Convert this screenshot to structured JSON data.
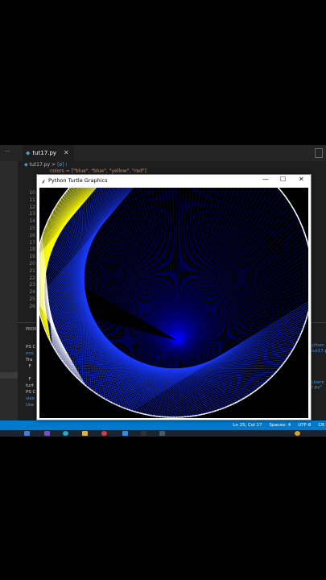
{
  "editor": {
    "tab_label": "tut17.py",
    "breadcrumb_file": "tut17.py",
    "breadcrumb_symbol": "[ø] i",
    "partial_code_line": "colors = [\"blue\", \"blue\", \"yellow\", \"red\"]",
    "line_numbers": [
      "10",
      "11",
      "12",
      "13",
      "14",
      "15",
      "16",
      "17",
      "18",
      "19",
      "20",
      "21",
      "22",
      "23",
      "24",
      "25",
      "26"
    ]
  },
  "panel": {
    "label": "PROBLEMS",
    "terminal_lines": [
      {
        "text": "PS C",
        "blue": false
      },
      {
        "text": "ons",
        "blue": true
      },
      {
        "text": "Tra",
        "blue": false
      },
      {
        "text": "  F",
        "blue": false
      },
      {
        "text": "",
        "blue": false
      },
      {
        "text": "  F",
        "blue": false
      },
      {
        "text": "turt",
        "blue": false
      },
      {
        "text": "PS C",
        "blue": false
      },
      {
        "text": "slee",
        "blue": true
      },
      {
        "text": "Use",
        "blue": true
      }
    ],
    "right_terminal_lines": [
      {
        "text": "ython",
        "blue": true
      },
      {
        "text": "tut17.p",
        "blue": true
      },
      {
        "text": "",
        "blue": false
      },
      {
        "text": "",
        "blue": false
      },
      {
        "text": "",
        "blue": false
      },
      {
        "text": "",
        "blue": false
      },
      {
        "text": "",
        "blue": false
      },
      {
        "text": "Users",
        "blue": true
      },
      {
        "text": "t.py\"",
        "blue": true
      }
    ]
  },
  "statusbar": {
    "position": "Ln 25, Col 17",
    "spaces": "Spaces: 4",
    "encoding": "UTF-8",
    "eol": "CR"
  },
  "turtle_window": {
    "title": "Python Turtle Graphics",
    "minimize": "—",
    "maximize": "☐",
    "close": "✕",
    "canvas_background": "#000000",
    "line_colors": [
      "#0000ff",
      "#ffff00",
      "#ffffff"
    ]
  }
}
